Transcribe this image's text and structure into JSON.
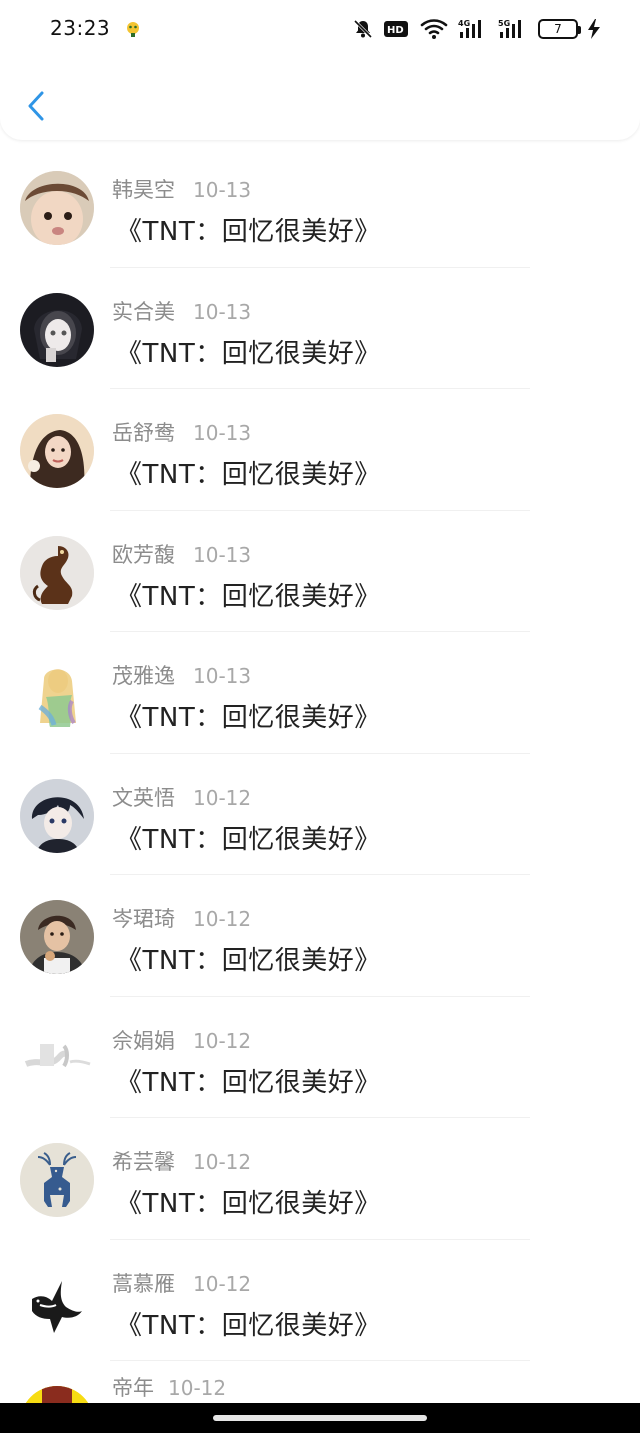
{
  "status_bar": {
    "time": "23:23",
    "battery": "7"
  },
  "list": {
    "items": [
      {
        "name": "韩昊空",
        "date": "10-13",
        "title": "《TNT：回忆很美好》",
        "avatar": "child-face-avatar"
      },
      {
        "name": "实合美",
        "date": "10-13",
        "title": "《TNT：回忆很美好》",
        "avatar": "anime-girl-avatar"
      },
      {
        "name": "岳舒鸯",
        "date": "10-13",
        "title": "《TNT：回忆很美好》",
        "avatar": "girl-portrait-avatar"
      },
      {
        "name": "欧芳馥",
        "date": "10-13",
        "title": "《TNT：回忆很美好》",
        "avatar": "statue-avatar"
      },
      {
        "name": "茂雅逸",
        "date": "10-13",
        "title": "《TNT：回忆很美好》",
        "avatar": "watercolor-girl-avatar"
      },
      {
        "name": "文英悟",
        "date": "10-12",
        "title": "《TNT：回忆很美好》",
        "avatar": "anime-boy-avatar"
      },
      {
        "name": "岑珺琦",
        "date": "10-12",
        "title": "《TNT：回忆很美好》",
        "avatar": "boy-photo-avatar"
      },
      {
        "name": "佘娟娟",
        "date": "10-12",
        "title": "《TNT：回忆很美好》",
        "avatar": "faded-sketch-avatar"
      },
      {
        "name": "希芸馨",
        "date": "10-12",
        "title": "《TNT：回忆很美好》",
        "avatar": "deer-avatar"
      },
      {
        "name": "蒿慕雁",
        "date": "10-12",
        "title": "《TNT：回忆很美好》",
        "avatar": "swallow-avatar"
      },
      {
        "name": "帝年",
        "date": "10-12",
        "title": "",
        "avatar": "yellow-avatar"
      }
    ]
  },
  "colors": {
    "accent": "#2f95e6",
    "name": "#8c8c8c",
    "date": "#a8a8a8",
    "title": "#222222"
  }
}
